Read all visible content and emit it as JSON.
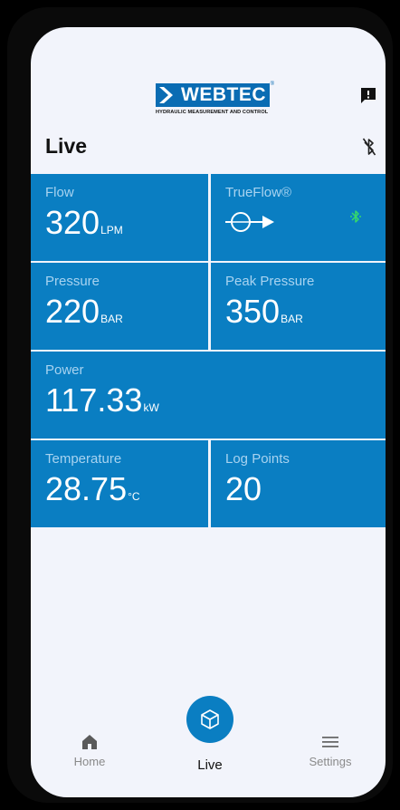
{
  "logo": {
    "word": "WEBTEC",
    "reg": "®",
    "tagline": "HYDRAULIC MEASUREMENT AND CONTROL"
  },
  "header": {
    "title": "Live"
  },
  "icons": {
    "feedback": "feedback-icon",
    "bluetooth_off": "bluetooth-disabled-icon",
    "bluetooth_on": "bluetooth-connected-icon",
    "trueflow": "flow-meter-icon"
  },
  "colors": {
    "tile": "#0a7ec2",
    "label": "#a8d3f0",
    "bluetooth_on": "#36d96a",
    "background": "#f2f4fb"
  },
  "tiles": {
    "flow": {
      "label": "Flow",
      "value": "320",
      "unit": "LPM"
    },
    "trueflow": {
      "label": "TrueFlow®"
    },
    "pressure": {
      "label": "Pressure",
      "value": "220",
      "unit": "BAR"
    },
    "peak_pressure": {
      "label": "Peak Pressure",
      "value": "350",
      "unit": "BAR"
    },
    "power": {
      "label": "Power",
      "value": "117.33",
      "unit": "kW"
    },
    "temperature": {
      "label": "Temperature",
      "value": "28.75",
      "unit": "°C"
    },
    "log_points": {
      "label": "Log Points",
      "value": "20"
    }
  },
  "nav": {
    "home": "Home",
    "live": "Live",
    "settings": "Settings"
  }
}
